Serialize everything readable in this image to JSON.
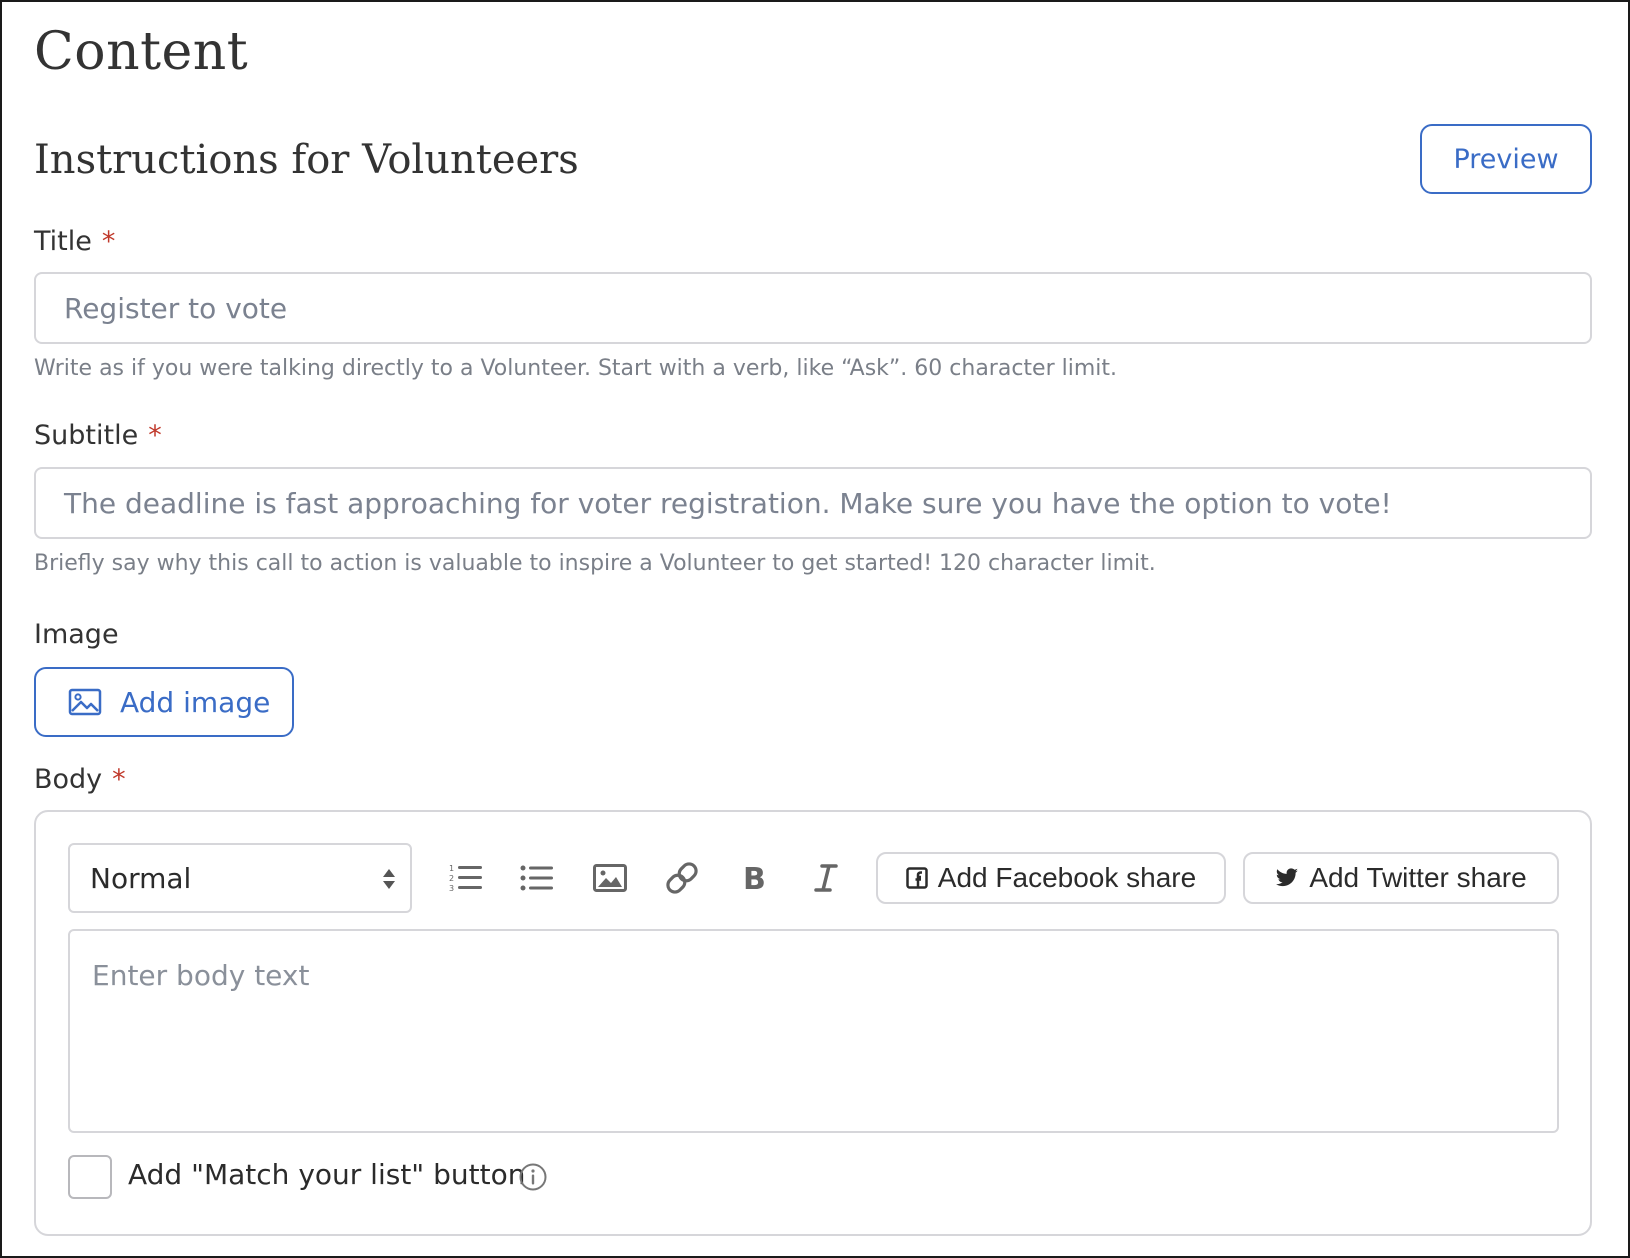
{
  "page": {
    "title": "Content"
  },
  "section": {
    "title": "Instructions for Volunteers",
    "preview_label": "Preview"
  },
  "fields": {
    "title": {
      "label": "Title",
      "required_mark": "*",
      "placeholder": "Register to vote",
      "hint": "Write as if you were talking directly to a Volunteer. Start with a verb, like “Ask”. 60 character limit."
    },
    "subtitle": {
      "label": "Subtitle",
      "required_mark": "*",
      "placeholder": "The deadline is fast approaching for voter registration. Make sure you have the option to vote!",
      "hint": "Briefly say why this call to action is valuable to inspire a Volunteer to get started! 120 character limit."
    },
    "image": {
      "label": "Image",
      "add_label": "Add image",
      "icon": "image-icon"
    },
    "body": {
      "label": "Body",
      "required_mark": "*",
      "format_select_value": "Normal",
      "toolbar_icons": [
        "ordered-list-icon",
        "unordered-list-icon",
        "insert-image-icon",
        "link-icon",
        "bold-icon",
        "italic-icon"
      ],
      "facebook_share_label": "Add Facebook share",
      "twitter_share_label": "Add Twitter share",
      "placeholder": "Enter body text",
      "match_list_label": "Add \"Match your list\" button",
      "match_list_checked": false
    }
  },
  "colors": {
    "accent": "#3a6cc6",
    "required": "#c0392b",
    "border": "#d6d6da",
    "muted_text": "#7a7f88"
  }
}
